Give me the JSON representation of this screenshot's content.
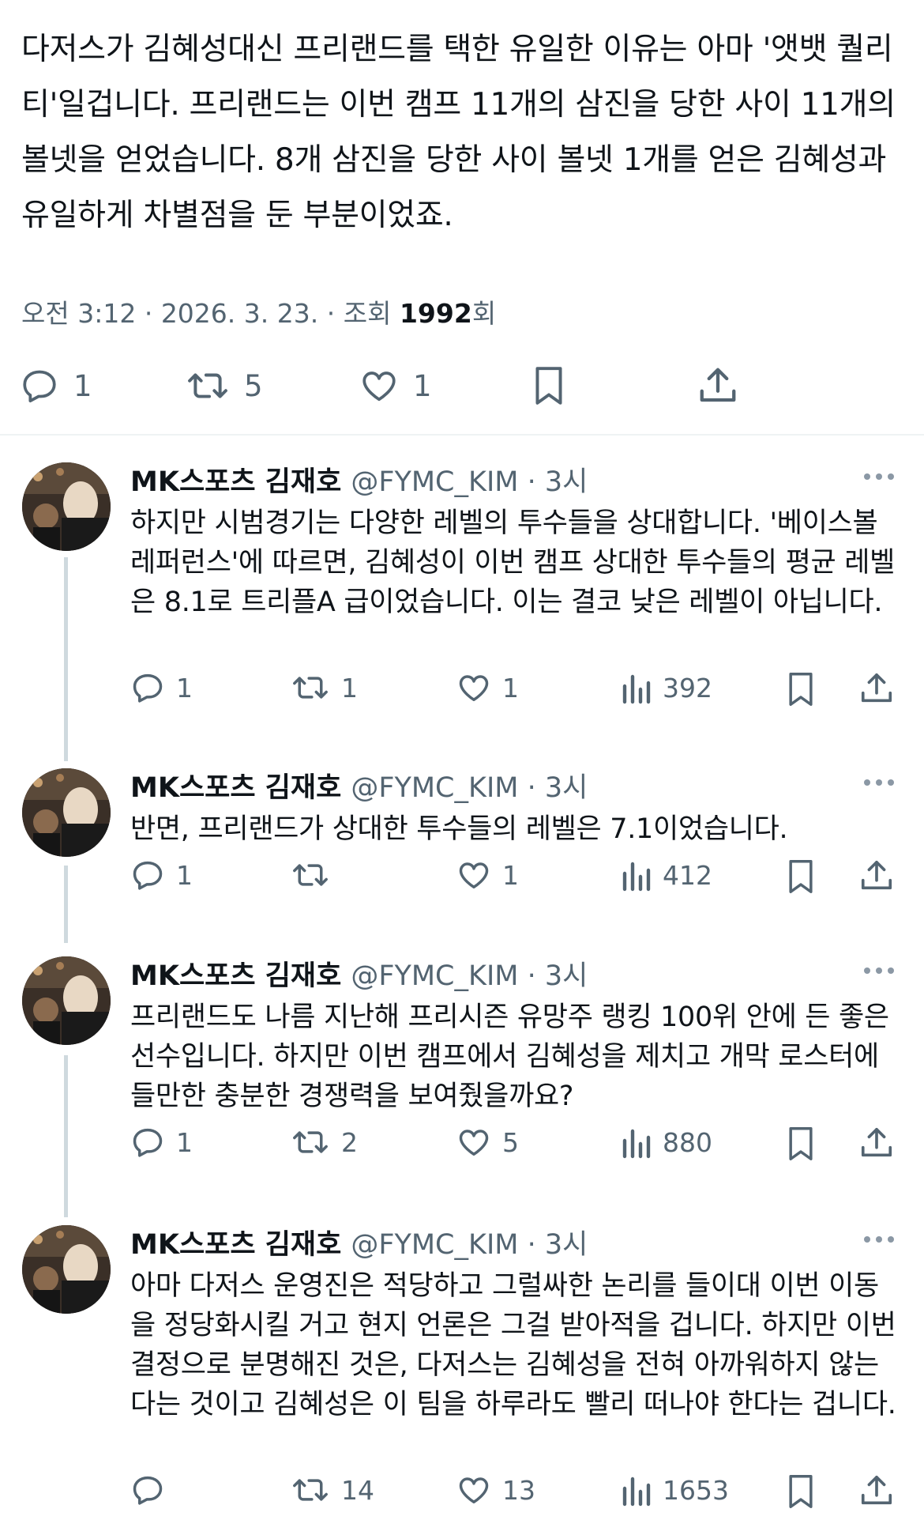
{
  "tweet": {
    "text": "다저스가 김혜성대신 프리랜드를 택한 유일한 이유는 아마 '앳뱃 퀄리티'일겁니다. 프리랜드는 이번 캠프 11개의 삼진을 당한 사이 11개의 볼넷을 얻었습니다. 8개 삼진을 당한 사이 볼넷 1개를 얻은 김혜성과 유일하게 차별점을 둔 부분이었죠.",
    "time": "오전 3:12",
    "date": "2026. 3. 23.",
    "views_label": "조회",
    "views_count": "1992",
    "views_suffix": "회",
    "actions": {
      "reply_count": "1",
      "retweet_count": "5",
      "like_count": "1"
    }
  },
  "replies": [
    {
      "name": "MK스포츠 김재호",
      "handle": "@FYMC_KIM",
      "time": "3시",
      "text": "하지만 시범경기는 다양한 레벨의 투수들을 상대합니다. '베이스볼 레퍼런스'에 따르면, 김혜성이 이번 캠프 상대한 투수들의 평균 레벨은 8.1로 트리플A 급이었습니다. 이는 결코 낮은 레벨이 아닙니다.",
      "reply_count": "1",
      "retweet_count": "1",
      "like_count": "1",
      "views_count": "392"
    },
    {
      "name": "MK스포츠 김재호",
      "handle": "@FYMC_KIM",
      "time": "3시",
      "text": "반면, 프리랜드가 상대한 투수들의 레벨은 7.1이었습니다.",
      "reply_count": "1",
      "retweet_count": "",
      "like_count": "1",
      "views_count": "412"
    },
    {
      "name": "MK스포츠 김재호",
      "handle": "@FYMC_KIM",
      "time": "3시",
      "text": "프리랜드도 나름 지난해 프리시즌 유망주 랭킹 100위 안에 든 좋은 선수입니다. 하지만 이번 캠프에서 김혜성을 제치고 개막 로스터에 들만한 충분한 경쟁력을 보여줬을까요?",
      "reply_count": "1",
      "retweet_count": "2",
      "like_count": "5",
      "views_count": "880"
    },
    {
      "name": "MK스포츠 김재호",
      "handle": "@FYMC_KIM",
      "time": "3시",
      "text": "아마 다저스 운영진은 적당하고 그럴싸한 논리를 들이대 이번 이동을 정당화시킬 거고 현지 언론은 그걸 받아적을 겁니다. 하지만 이번 결정으로 분명해진 것은, 다저스는 김혜성을 전혀 아까워하지 않는다는 것이고 김혜성은 이 팀을 하루라도 빨리 떠나야 한다는 겁니다.",
      "reply_count": "",
      "retweet_count": "14",
      "like_count": "13",
      "views_count": "1653"
    }
  ],
  "colors": {
    "text": "#0f1419",
    "secondary": "#536471",
    "thread_line": "#cfd9de",
    "divider": "#eff3f4"
  },
  "icons": [
    "reply-icon",
    "retweet-icon",
    "like-icon",
    "bookmark-icon",
    "share-icon",
    "views-icon",
    "more-icon"
  ]
}
